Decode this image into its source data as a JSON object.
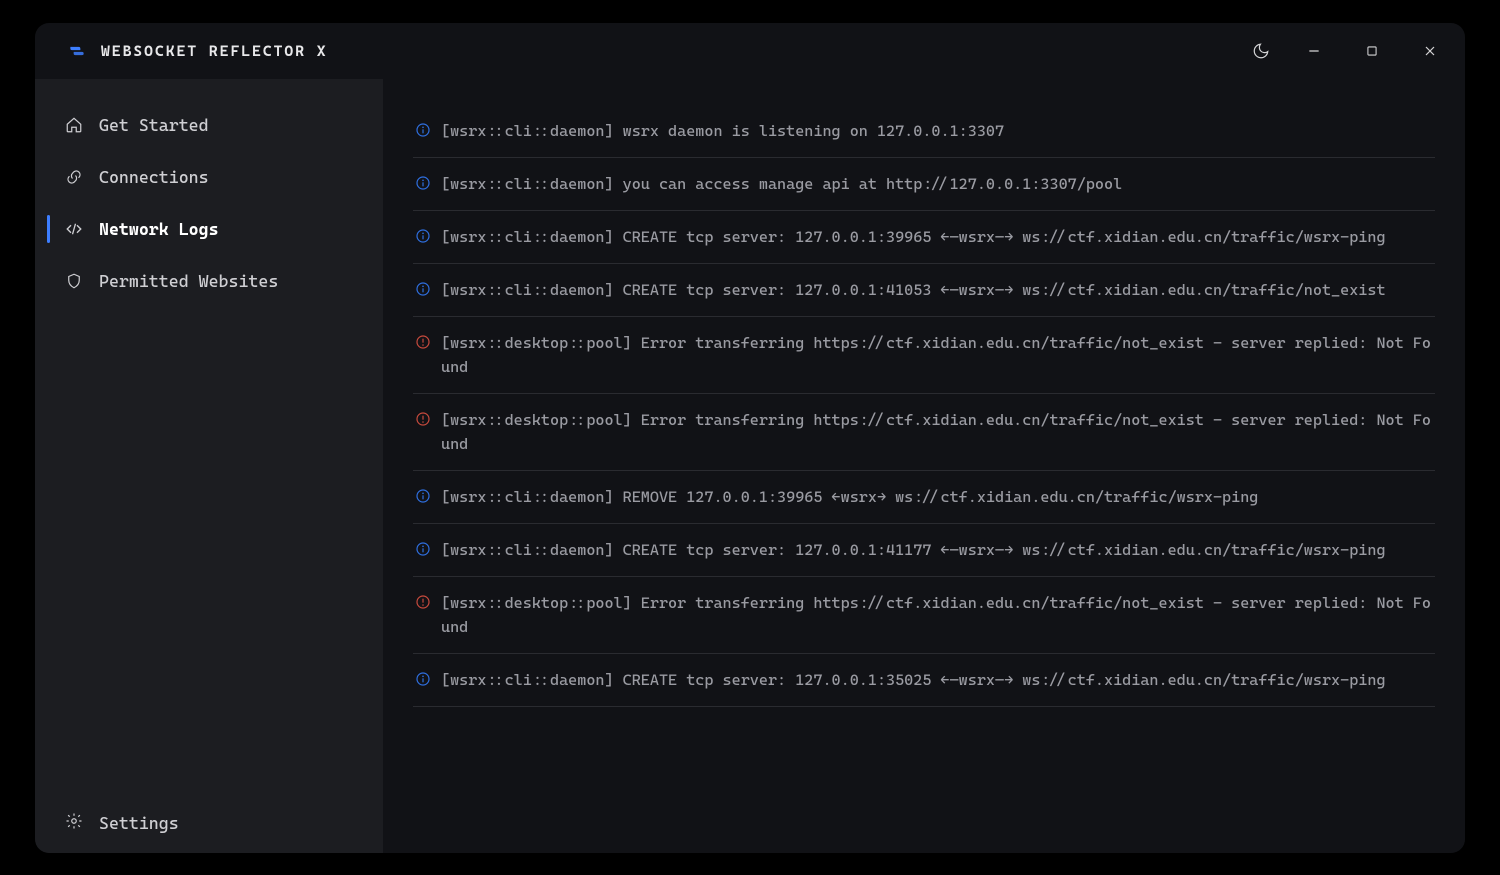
{
  "app": {
    "title": "WEBSOCKET REFLECTOR X"
  },
  "window_controls": {
    "theme": "theme-toggle",
    "minimize": "minimize",
    "maximize": "maximize",
    "close": "close"
  },
  "sidebar": {
    "items": [
      {
        "id": "get-started",
        "label": "Get Started",
        "icon": "home-icon"
      },
      {
        "id": "connections",
        "label": "Connections",
        "icon": "link-icon"
      },
      {
        "id": "network-logs",
        "label": "Network Logs",
        "icon": "code-icon",
        "active": true
      },
      {
        "id": "permitted-websites",
        "label": "Permitted Websites",
        "icon": "shield-icon"
      }
    ],
    "settings_label": "Settings"
  },
  "logs": [
    {
      "level": "info",
      "text": "[wsrx::cli::daemon] wsrx daemon is listening on 127.0.0.1:3307"
    },
    {
      "level": "info",
      "text": "[wsrx::cli::daemon] you can access manage api at http://127.0.0.1:3307/pool"
    },
    {
      "level": "info",
      "text": "[wsrx::cli::daemon] CREATE tcp server: 127.0.0.1:39965 ←—wsrx—→ ws://ctf.xidian.edu.cn/traffic/wsrx-ping"
    },
    {
      "level": "info",
      "text": "[wsrx::cli::daemon] CREATE tcp server: 127.0.0.1:41053 ←—wsrx—→ ws://ctf.xidian.edu.cn/traffic/not_exist"
    },
    {
      "level": "error",
      "text": "[wsrx::desktop::pool] Error transferring https://ctf.xidian.edu.cn/traffic/not_exist - server replied: Not Found"
    },
    {
      "level": "error",
      "text": "[wsrx::desktop::pool] Error transferring https://ctf.xidian.edu.cn/traffic/not_exist - server replied: Not Found"
    },
    {
      "level": "info",
      "text": "[wsrx::cli::daemon] REMOVE 127.0.0.1:39965 ←wsrx→ ws://ctf.xidian.edu.cn/traffic/wsrx-ping"
    },
    {
      "level": "info",
      "text": "[wsrx::cli::daemon] CREATE tcp server: 127.0.0.1:41177 ←—wsrx—→ ws://ctf.xidian.edu.cn/traffic/wsrx-ping"
    },
    {
      "level": "error",
      "text": "[wsrx::desktop::pool] Error transferring https://ctf.xidian.edu.cn/traffic/not_exist - server replied: Not Found"
    },
    {
      "level": "info",
      "text": "[wsrx::cli::daemon] CREATE tcp server: 127.0.0.1:35025 ←—wsrx—→ ws://ctf.xidian.edu.cn/traffic/wsrx-ping"
    }
  ]
}
